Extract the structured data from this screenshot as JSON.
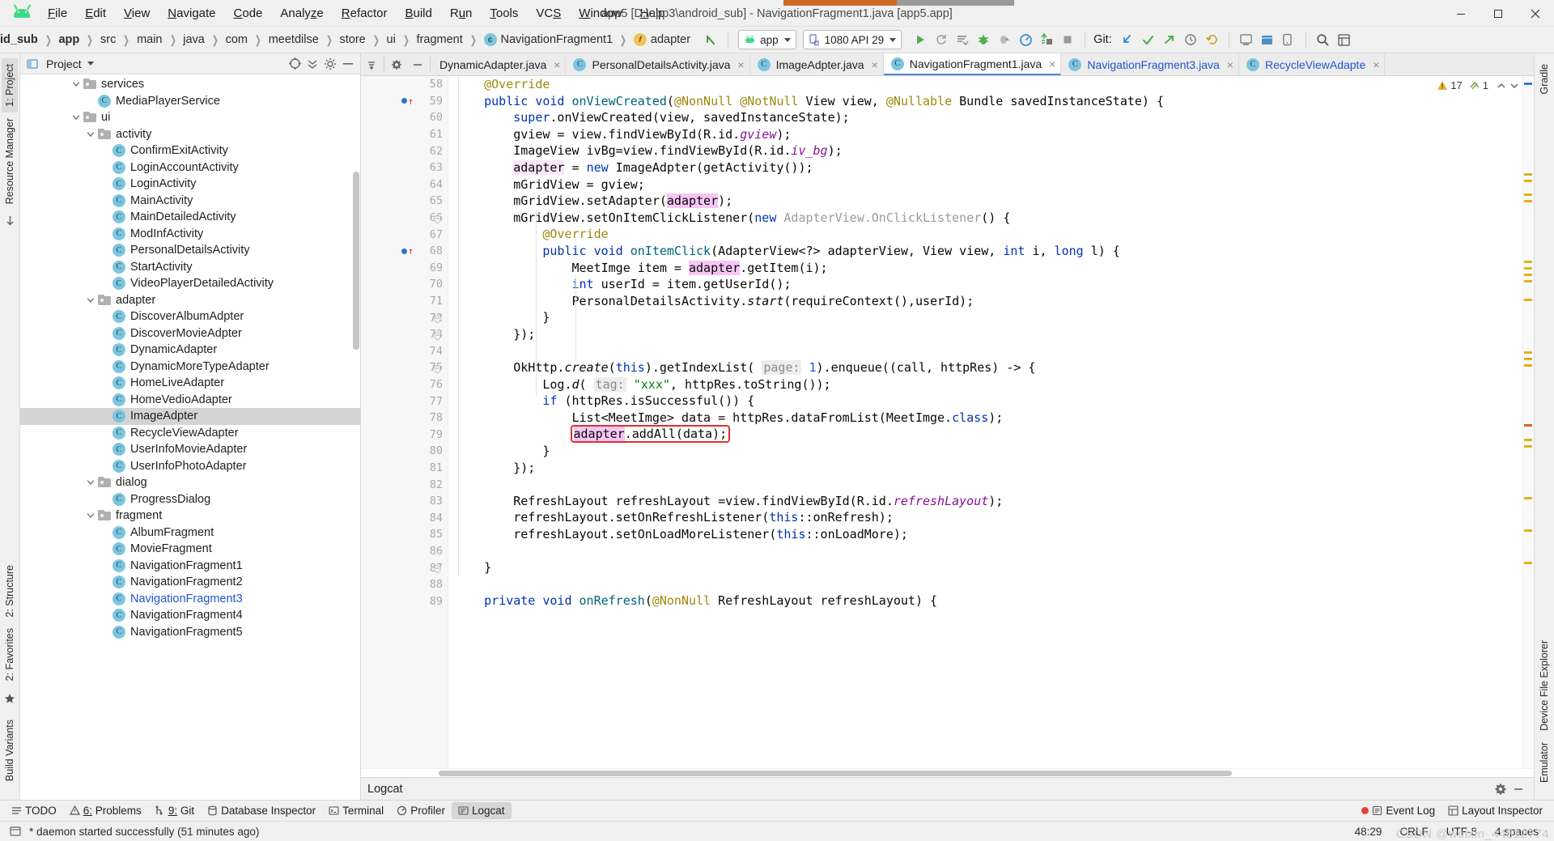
{
  "window": {
    "title": "app5 [D:\\app3\\android_sub] - NavigationFragment1.java [app5.app]",
    "minimize_label": "–",
    "maximize_label": "□",
    "close_label": "×"
  },
  "menu": [
    {
      "label": "File",
      "mnemonic": "F"
    },
    {
      "label": "Edit",
      "mnemonic": "E"
    },
    {
      "label": "View",
      "mnemonic": "V"
    },
    {
      "label": "Navigate",
      "mnemonic": "N"
    },
    {
      "label": "Code",
      "mnemonic": "C"
    },
    {
      "label": "Analyze",
      "mnemonic": "z"
    },
    {
      "label": "Refactor",
      "mnemonic": "R"
    },
    {
      "label": "Build",
      "mnemonic": "B"
    },
    {
      "label": "Run",
      "mnemonic": "u"
    },
    {
      "label": "Tools",
      "mnemonic": "T"
    },
    {
      "label": "VCS",
      "mnemonic": "S"
    },
    {
      "label": "Window",
      "mnemonic": "W"
    },
    {
      "label": "Help",
      "mnemonic": "H"
    }
  ],
  "breadcrumbs": [
    {
      "label": "id_sub",
      "bold": true,
      "badge": ""
    },
    {
      "label": "app",
      "bold": true,
      "badge": ""
    },
    {
      "label": "src",
      "bold": false,
      "badge": ""
    },
    {
      "label": "main",
      "bold": false,
      "badge": ""
    },
    {
      "label": "java",
      "bold": false,
      "badge": ""
    },
    {
      "label": "com",
      "bold": false,
      "badge": ""
    },
    {
      "label": "meetdilse",
      "bold": false,
      "badge": ""
    },
    {
      "label": "store",
      "bold": false,
      "badge": ""
    },
    {
      "label": "ui",
      "bold": false,
      "badge": ""
    },
    {
      "label": "fragment",
      "bold": false,
      "badge": ""
    },
    {
      "label": "NavigationFragment1",
      "bold": false,
      "badge": "c"
    },
    {
      "label": "adapter",
      "bold": false,
      "badge": "f"
    }
  ],
  "toolbar": {
    "module_combo": "app",
    "device_combo": "1080 API 29",
    "git_label": "Git:",
    "icons": [
      "run-icon",
      "rerun-icon",
      "apply-changes-icon",
      "debug-icon",
      "attach-debugger-icon",
      "profiler-icon",
      "apply-code-changes-icon",
      "stop-icon",
      "git-update-icon",
      "git-commit-icon",
      "git-push-icon",
      "history-icon",
      "undo-icon",
      "avd-manager-icon",
      "sdk-manager-icon",
      "search-everywhere-icon",
      "project-structure-icon"
    ]
  },
  "project_panel": {
    "title": "Project",
    "header_icons": [
      "locate-icon",
      "collapse-all-icon",
      "settings-icon",
      "hide-icon"
    ],
    "tree": [
      {
        "depth": 3,
        "type": "folder",
        "label": "services",
        "expanded": true
      },
      {
        "depth": 4,
        "type": "class",
        "label": "MediaPlayerService"
      },
      {
        "depth": 3,
        "type": "folder",
        "label": "ui",
        "expanded": true
      },
      {
        "depth": 4,
        "type": "folder",
        "label": "activity",
        "expanded": true
      },
      {
        "depth": 5,
        "type": "class",
        "label": "ConfirmExitActivity"
      },
      {
        "depth": 5,
        "type": "class",
        "label": "LoginAccountActivity"
      },
      {
        "depth": 5,
        "type": "class",
        "label": "LoginActivity"
      },
      {
        "depth": 5,
        "type": "class",
        "label": "MainActivity"
      },
      {
        "depth": 5,
        "type": "class",
        "label": "MainDetailedActivity"
      },
      {
        "depth": 5,
        "type": "class",
        "label": "ModInfActivity"
      },
      {
        "depth": 5,
        "type": "class",
        "label": "PersonalDetailsActivity"
      },
      {
        "depth": 5,
        "type": "class",
        "label": "StartActivity"
      },
      {
        "depth": 5,
        "type": "class",
        "label": "VideoPlayerDetailedActivity"
      },
      {
        "depth": 4,
        "type": "folder",
        "label": "adapter",
        "expanded": true
      },
      {
        "depth": 5,
        "type": "class",
        "label": "DiscoverAlbumAdpter"
      },
      {
        "depth": 5,
        "type": "class",
        "label": "DiscoverMovieAdpter"
      },
      {
        "depth": 5,
        "type": "class",
        "label": "DynamicAdapter"
      },
      {
        "depth": 5,
        "type": "class",
        "label": "DynamicMoreTypeAdapter"
      },
      {
        "depth": 5,
        "type": "class",
        "label": "HomeLiveAdapter"
      },
      {
        "depth": 5,
        "type": "class",
        "label": "HomeVedioAdapter"
      },
      {
        "depth": 5,
        "type": "class",
        "label": "ImageAdpter",
        "selected": true
      },
      {
        "depth": 5,
        "type": "class",
        "label": "RecycleViewAdapter"
      },
      {
        "depth": 5,
        "type": "class",
        "label": "UserInfoMovieAdapter"
      },
      {
        "depth": 5,
        "type": "class",
        "label": "UserInfoPhotoAdapter"
      },
      {
        "depth": 4,
        "type": "folder",
        "label": "dialog",
        "expanded": true
      },
      {
        "depth": 5,
        "type": "class",
        "label": "ProgressDialog"
      },
      {
        "depth": 4,
        "type": "folder",
        "label": "fragment",
        "expanded": true
      },
      {
        "depth": 5,
        "type": "class",
        "label": "AlbumFragment"
      },
      {
        "depth": 5,
        "type": "class",
        "label": "MovieFragment"
      },
      {
        "depth": 5,
        "type": "class",
        "label": "NavigationFragment1"
      },
      {
        "depth": 5,
        "type": "class",
        "label": "NavigationFragment2"
      },
      {
        "depth": 5,
        "type": "class",
        "label": "NavigationFragment3",
        "link": true
      },
      {
        "depth": 5,
        "type": "class",
        "label": "NavigationFragment4"
      },
      {
        "depth": 5,
        "type": "class",
        "label": "NavigationFragment5"
      }
    ]
  },
  "editor": {
    "tabs": [
      {
        "label": "DynamicAdapter.java",
        "icon": false,
        "active": false,
        "clipped": true
      },
      {
        "label": "PersonalDetailsActivity.java",
        "icon": true,
        "active": false
      },
      {
        "label": "ImageAdpter.java",
        "icon": true,
        "active": false
      },
      {
        "label": "NavigationFragment1.java",
        "icon": true,
        "active": true
      },
      {
        "label": "NavigationFragment3.java",
        "icon": true,
        "active": false,
        "link": true
      },
      {
        "label": "RecycleViewAdapte",
        "icon": true,
        "active": false,
        "link": true
      }
    ],
    "inspections": {
      "warnings": "17",
      "weak_warnings": "1"
    },
    "first_line_number": 58,
    "lines": [
      {
        "n": 58,
        "html": "    <span class=\"ann\">@Override</span>"
      },
      {
        "n": 59,
        "html": "    <span class=\"kw\">public</span> <span class=\"kw\">void</span> <span class=\"mth\">onViewCreated</span>(<span class=\"ann\">@NonNull</span> <span class=\"ann\">@NotNull</span> View view, <span class=\"ann\">@Nullable</span> Bundle savedInstanceState) {",
        "marker": "override"
      },
      {
        "n": 60,
        "html": "        <span class=\"kw\">super</span>.onViewCreated(view, savedInstanceState);"
      },
      {
        "n": 61,
        "html": "        gview = view.findViewById(R.id.<span class=\"fld\">gview</span>);"
      },
      {
        "n": 62,
        "html": "        ImageView ivBg=view.findViewById(R.id.<span class=\"fld\">iv_bg</span>);"
      },
      {
        "n": 63,
        "html": "        <span class=\"hl2\">adapter</span> = <span class=\"kw\">new</span> ImageAdpter(getActivity());"
      },
      {
        "n": 64,
        "html": "        mGridView = gview;"
      },
      {
        "n": 65,
        "html": "        mGridView.setAdapter(<span class=\"hl\">adapter</span>);"
      },
      {
        "n": 66,
        "html": "        mGridView.setOnItemClickListener(<span class=\"kw\">new</span> <span class=\"grey\">AdapterView.OnClickListener</span>() {",
        "fold": true
      },
      {
        "n": 67,
        "html": "            <span class=\"ann\">@Override</span>"
      },
      {
        "n": 68,
        "html": "            <span class=\"kw\">public</span> <span class=\"kw\">void</span> <span class=\"mth\">onItemClick</span>(AdapterView&lt;?&gt; adapterView, View view, <span class=\"kw\">int</span> i, <span class=\"kw\">long</span> l) {",
        "marker": "override"
      },
      {
        "n": 69,
        "html": "                MeetImge item = <span class=\"hl\">adapter</span>.getItem(i);"
      },
      {
        "n": 70,
        "html": "                <span class=\"kw\">int</span> userId = item.getUserId();"
      },
      {
        "n": 71,
        "html": "                PersonalDetailsActivity.<span class=\"itl\">start</span>(requireContext(),userId);"
      },
      {
        "n": 72,
        "html": "            }",
        "fold": true
      },
      {
        "n": 73,
        "html": "        });",
        "fold": true
      },
      {
        "n": 74,
        "html": ""
      },
      {
        "n": 75,
        "html": "        OkHttp.<span class=\"itl\">create</span>(<span class=\"kw\">this</span>).getIndexList( <span class=\"hint\">page:</span> <span class=\"num\">1</span>).enqueue((call, httpRes) -&gt; {",
        "fold": true
      },
      {
        "n": 76,
        "html": "            Log.<span class=\"itl\">d</span>( <span class=\"hint\">tag:</span> <span class=\"str\">\"xxx\"</span>, httpRes.toString());"
      },
      {
        "n": 77,
        "html": "            <span class=\"kw\">if</span> (httpRes.isSuccessful()) {"
      },
      {
        "n": 78,
        "html": "                List&lt;MeetImge&gt; data = httpRes.dataFromList(MeetImge.<span class=\"kw\">class</span>);"
      },
      {
        "n": 79,
        "html": "                <span class=\"boxed\"><span class=\"hl\">adapter</span>.addAll(data);</span>",
        "boxed": true
      },
      {
        "n": 80,
        "html": "            }"
      },
      {
        "n": 81,
        "html": "        });"
      },
      {
        "n": 82,
        "html": ""
      },
      {
        "n": 83,
        "html": "        RefreshLayout refreshLayout =view.findViewById(R.id.<span class=\"fld\">refreshLayout</span>);"
      },
      {
        "n": 84,
        "html": "        refreshLayout.setOnRefreshListener(<span class=\"kw\">this</span>::onRefresh);"
      },
      {
        "n": 85,
        "html": "        refreshLayout.setOnLoadMoreListener(<span class=\"kw\">this</span>::onLoadMore);"
      },
      {
        "n": 86,
        "html": ""
      },
      {
        "n": 87,
        "html": "    }",
        "fold": true
      },
      {
        "n": 88,
        "html": ""
      },
      {
        "n": 89,
        "html": "    <span class=\"kw\">private</span> <span class=\"kw\">void</span> <span class=\"mth\">onRefresh</span>(<span class=\"ann\">@NonNull</span> RefreshLayout refreshLayout) {"
      }
    ]
  },
  "logcat_panel": {
    "title": "Logcat",
    "icons": [
      "settings-icon",
      "hide-icon"
    ]
  },
  "bottom_bar": {
    "left_items": [
      {
        "label": "TODO",
        "icon": "todo-icon",
        "prefix": ""
      },
      {
        "label": "Problems",
        "icon": "problems-icon",
        "prefix": "6:"
      },
      {
        "label": "Git",
        "icon": "git-icon",
        "prefix": "9:"
      },
      {
        "label": "Database Inspector",
        "icon": "database-icon",
        "prefix": ""
      },
      {
        "label": "Terminal",
        "icon": "terminal-icon",
        "prefix": ""
      },
      {
        "label": "Profiler",
        "icon": "profiler-icon",
        "prefix": ""
      },
      {
        "label": "Logcat",
        "icon": "logcat-icon",
        "prefix": "",
        "active": true
      }
    ],
    "right_items": [
      {
        "label": "Event Log",
        "icon": "event-log-icon",
        "badge": true
      },
      {
        "label": "Layout Inspector",
        "icon": "layout-inspector-icon"
      }
    ]
  },
  "left_strip": [
    {
      "label": "1: Project",
      "active": true
    },
    {
      "label": "Resource Manager",
      "active": false
    }
  ],
  "left_strip_bottom": [
    {
      "label": "2: Structure"
    },
    {
      "label": "2: Favorites"
    },
    {
      "label": "Build Variants"
    }
  ],
  "right_strip": [
    {
      "label": "Gradle"
    },
    {
      "label": "Device File Explorer"
    },
    {
      "label": "Emulator"
    }
  ],
  "statusbar": {
    "message": "* daemon started successfully (51 minutes ago)",
    "caret_position": "48:29",
    "line_separator": "CRLF",
    "encoding": "UTF-8",
    "indent": "4 spaces",
    "watermark": "CSDN @weixin_44812774"
  },
  "colors": {
    "accent_blue": "#4f87d4",
    "android_green": "#3ddc84",
    "class_icon": "#7bc6e0",
    "highlight_pink": "#f7c6f7",
    "error_red": "#e03030",
    "warning_yellow": "#e0b020",
    "selection_grey": "#d4d4d4"
  }
}
